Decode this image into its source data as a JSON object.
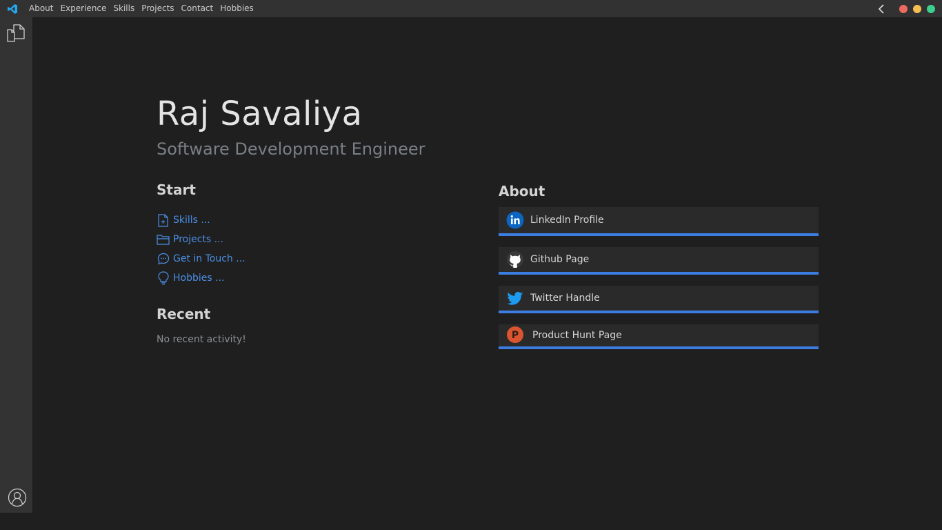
{
  "menu": [
    "About",
    "Experience",
    "Skills",
    "Projects",
    "Contact",
    "Hobbies"
  ],
  "header": {
    "name": "Raj Savaliya",
    "role": "Software Development Engineer"
  },
  "start": {
    "title": "Start",
    "items": [
      {
        "label": "Skills ...",
        "icon": "new-file-icon"
      },
      {
        "label": "Projects ...",
        "icon": "folder-icon"
      },
      {
        "label": "Get in Touch ...",
        "icon": "chat-bubble-icon"
      },
      {
        "label": "Hobbies ...",
        "icon": "lightbulb-icon"
      }
    ]
  },
  "recent": {
    "title": "Recent",
    "empty_text": "No recent activity!"
  },
  "about": {
    "title": "About",
    "links": [
      {
        "label": "LinkedIn Profile",
        "icon": "linkedin-icon",
        "color": "#0a66c2"
      },
      {
        "label": "Github Page",
        "icon": "github-icon",
        "color": "#ffffff"
      },
      {
        "label": "Twitter Handle",
        "icon": "twitter-icon",
        "color": "#1d9bf0"
      },
      {
        "label": "Product Hunt Page",
        "icon": "product-hunt-icon",
        "color": "#da552f",
        "glyph": "P"
      }
    ]
  },
  "colors": {
    "accent": "#3c7de1",
    "link": "#4b90e6",
    "background": "#1f1f1f"
  }
}
